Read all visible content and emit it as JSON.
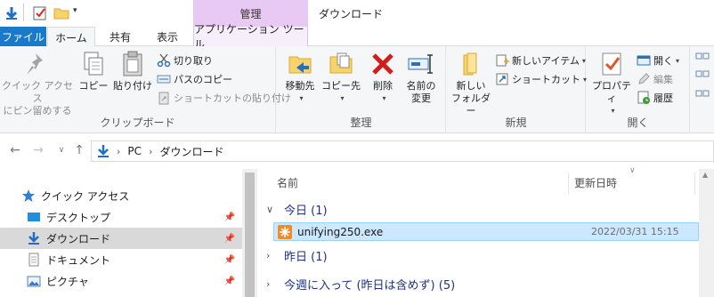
{
  "window": {
    "context_tab_group": "管理",
    "title": "ダウンロード"
  },
  "tabs": {
    "file": "ファイル",
    "home": "ホーム",
    "share": "共有",
    "view": "表示",
    "app_tools": "アプリケーション ツール"
  },
  "ribbon": {
    "clipboard": {
      "pin_quick_access": [
        "クイック アクセス",
        "にピン留めする"
      ],
      "copy": "コピー",
      "paste": "貼り付け",
      "cut": "切り取り",
      "copy_path": "パスのコピー",
      "paste_shortcut": "ショートカットの貼り付け",
      "group_label": "クリップボード"
    },
    "organize": {
      "move_to": "移動先",
      "copy_to": "コピー先",
      "delete": "削除",
      "rename": [
        "名前の",
        "変更"
      ],
      "group_label": "整理"
    },
    "new": {
      "new_folder": [
        "新しい",
        "フォルダー"
      ],
      "new_item": "新しいアイテム",
      "easy_access": "ショートカット",
      "group_label": "新規"
    },
    "open": {
      "properties": "プロパティ",
      "open": "開く",
      "edit": "編集",
      "history": "履歴",
      "group_label": "開く"
    }
  },
  "address": {
    "crumbs": [
      "PC",
      "ダウンロード"
    ]
  },
  "nav": {
    "items": [
      {
        "label": "クイック アクセス"
      },
      {
        "label": "デスクトップ"
      },
      {
        "label": "ダウンロード"
      },
      {
        "label": "ドキュメント"
      },
      {
        "label": "ピクチャ"
      }
    ]
  },
  "list": {
    "col_name": "名前",
    "col_date": "更新日時",
    "groups": [
      {
        "label": "今日 (1)"
      },
      {
        "label": "昨日 (1)"
      },
      {
        "label": "今週に入って (昨日は含めず) (5)"
      }
    ],
    "files": [
      {
        "name": "unifying250.exe",
        "date": "2022/03/31 15:15"
      }
    ]
  },
  "colors": {
    "file_tab": "#1979ca",
    "context_tab": "#e8c9f3",
    "selection": "#cce8ff"
  }
}
